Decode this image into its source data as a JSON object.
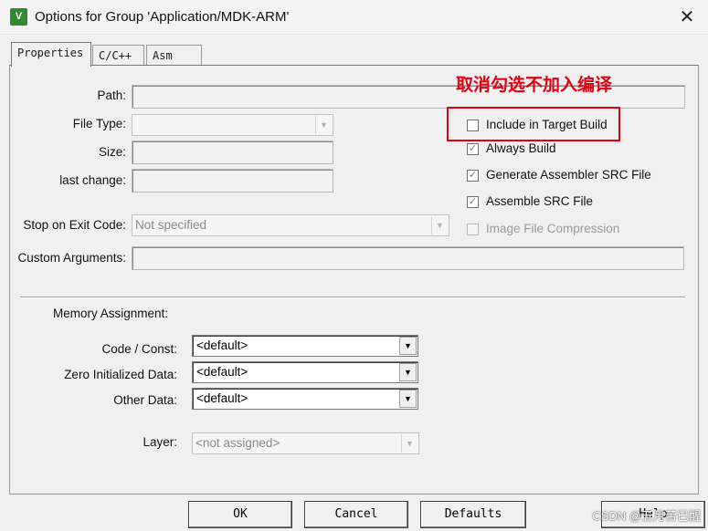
{
  "window": {
    "title": "Options for Group 'Application/MDK-ARM'",
    "close_glyph": "✕",
    "icon_text": "V"
  },
  "tabs": [
    {
      "label": "Properties"
    },
    {
      "label": "C/C++"
    },
    {
      "label": "Asm"
    }
  ],
  "fields": {
    "path_label": "Path:",
    "file_type_label": "File Type:",
    "size_label": "Size:",
    "last_change_label": "last change:",
    "stop_on_exit_label": "Stop on Exit Code:",
    "stop_on_exit_value": "Not specified",
    "custom_args_label": "Custom Arguments:"
  },
  "options": [
    {
      "label": "Include in Target Build",
      "checked": false,
      "enabled": true
    },
    {
      "label": "Always Build",
      "checked": true,
      "enabled": true
    },
    {
      "label": "Generate Assembler SRC File",
      "checked": true,
      "enabled": true
    },
    {
      "label": "Assemble SRC File",
      "checked": true,
      "enabled": true
    },
    {
      "label": "Image File Compression",
      "checked": false,
      "enabled": false
    }
  ],
  "annotation": {
    "text": "取消勾选不加入编译",
    "color": "#e60012"
  },
  "memory": {
    "heading": "Memory Assignment:",
    "code_const_label": "Code / Const:",
    "code_const_value": "<default>",
    "zero_init_label": "Zero Initialized Data:",
    "zero_init_value": "<default>",
    "other_data_label": "Other Data:",
    "other_data_value": "<default>",
    "layer_label": "Layer:",
    "layer_value": "<not assigned>"
  },
  "buttons": {
    "ok": "OK",
    "cancel": "Cancel",
    "defaults": "Defaults",
    "help": "Help"
  },
  "watermark": "CSDN @五月苦已醒"
}
